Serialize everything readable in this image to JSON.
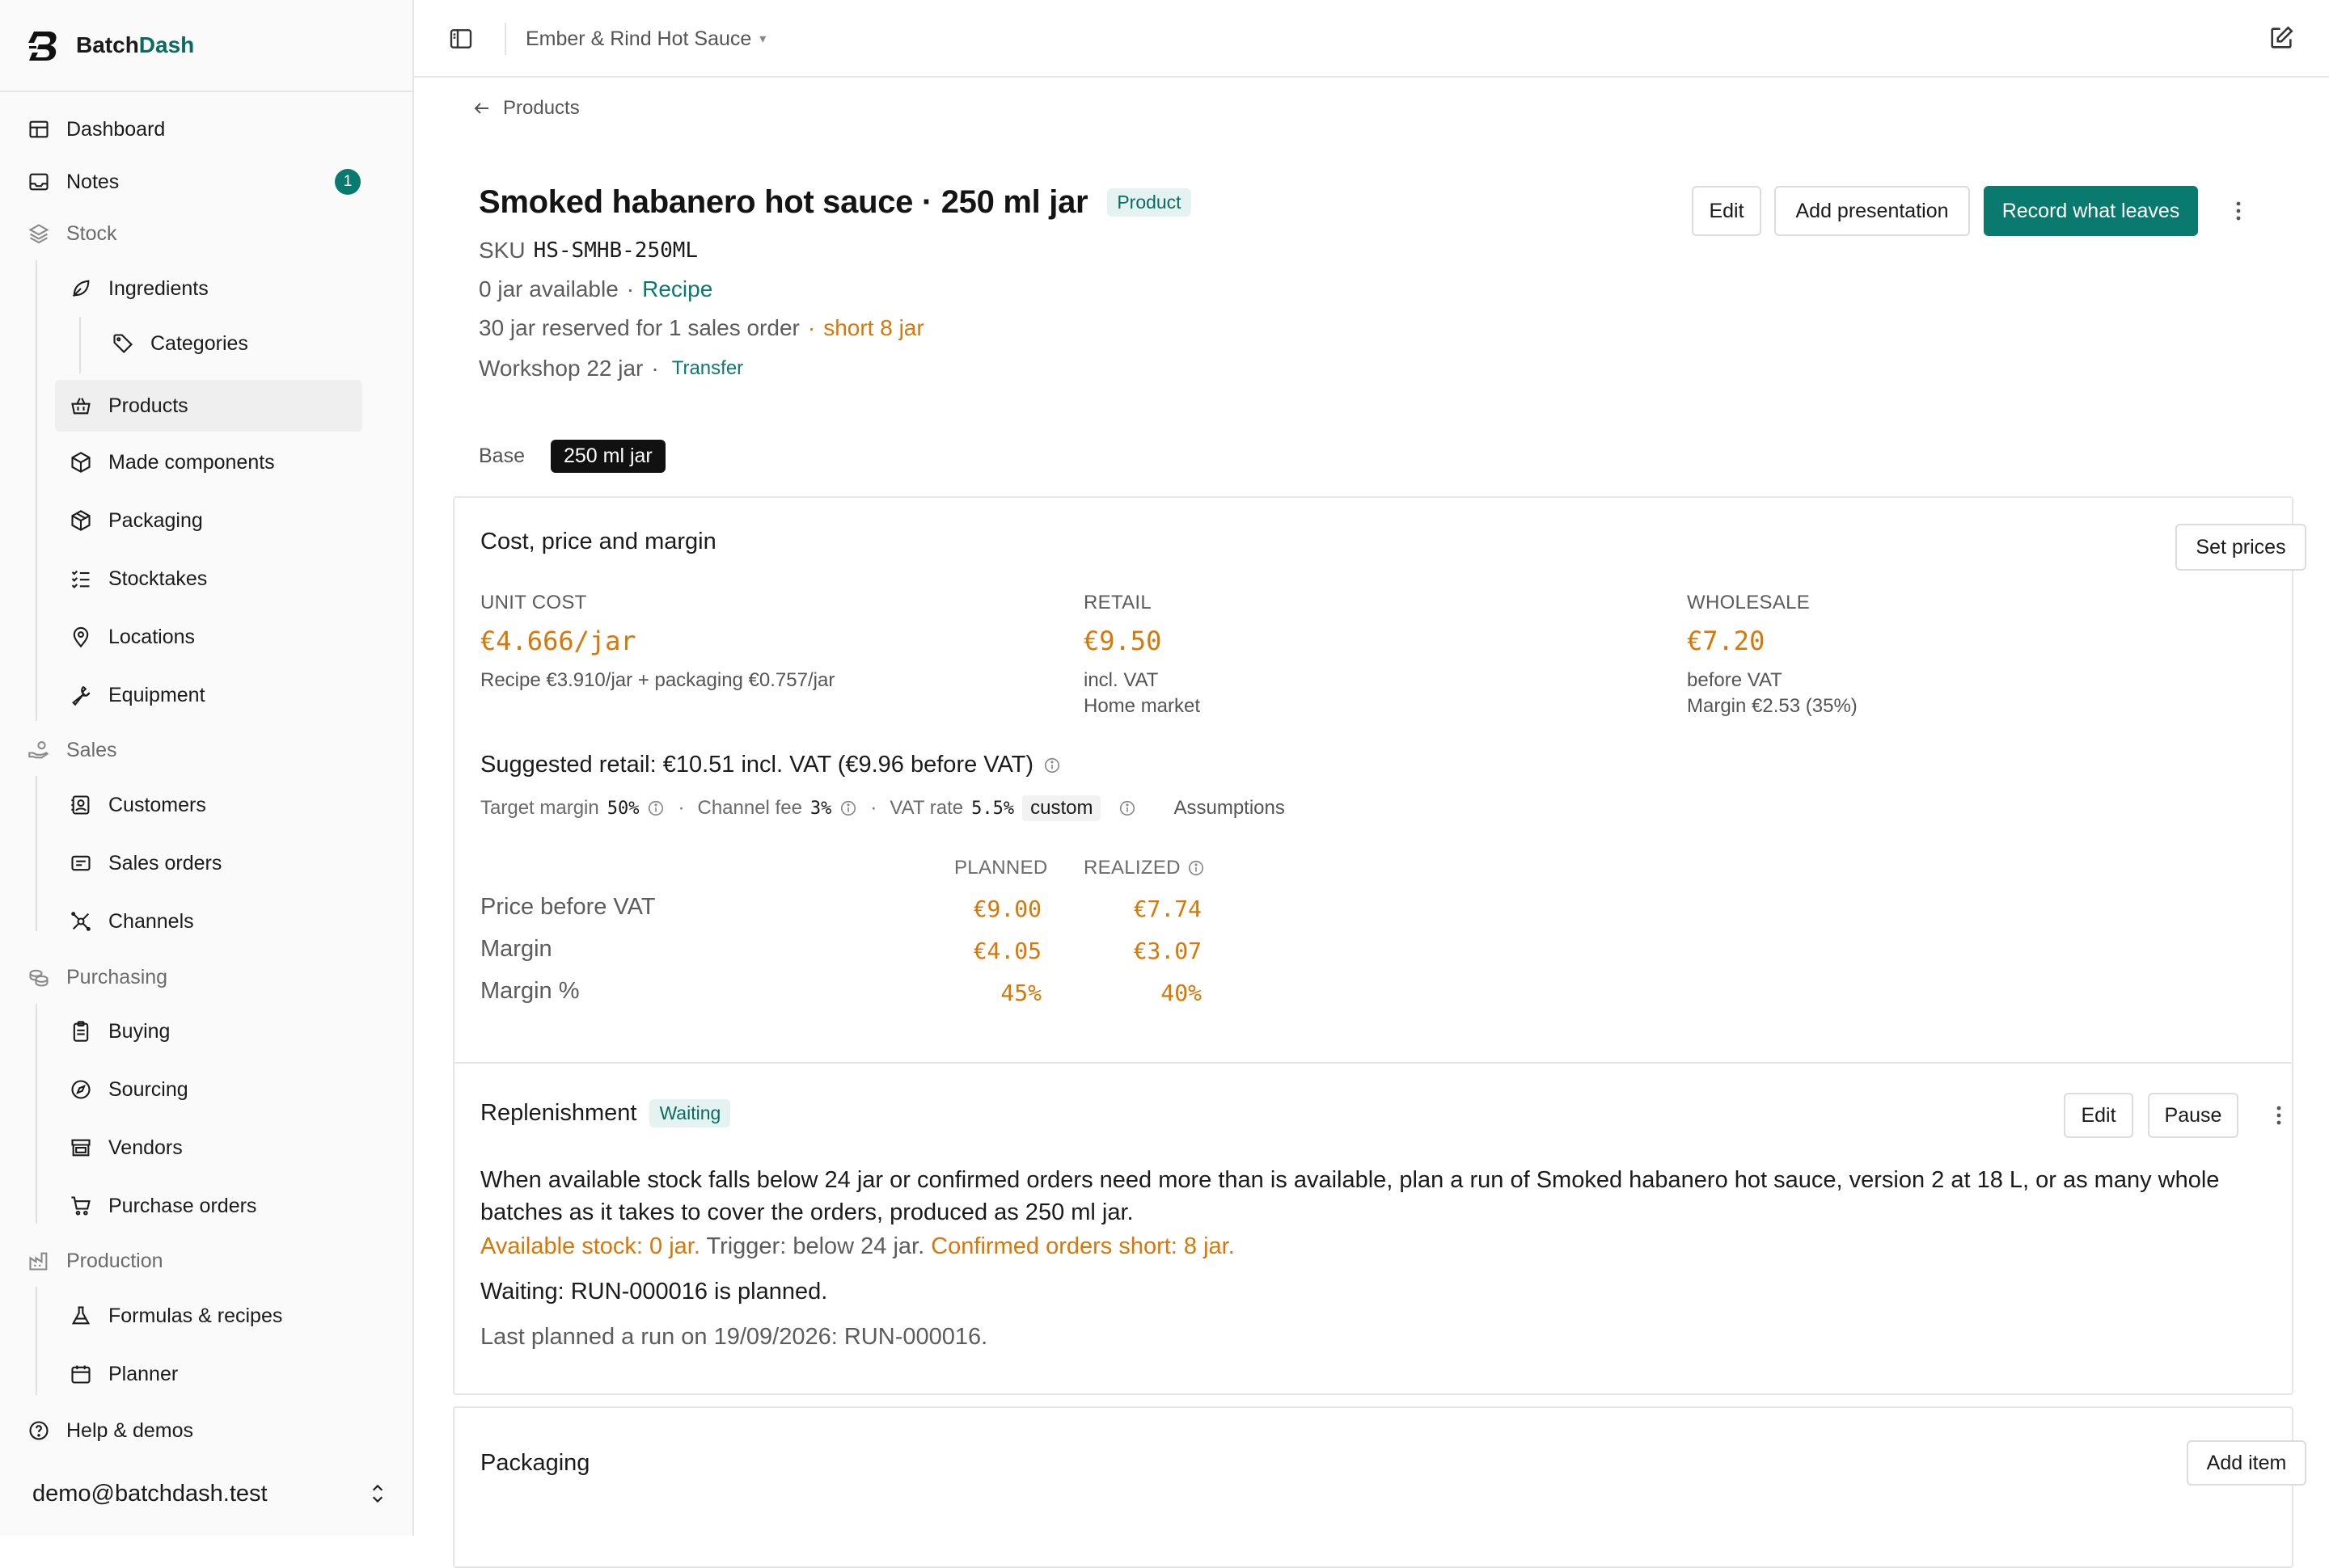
{
  "app": {
    "brand_first": "Batch",
    "brand_second": "Dash"
  },
  "sidebar": {
    "items": [
      {
        "label": "Dashboard"
      },
      {
        "label": "Notes",
        "badge": "1"
      },
      {
        "label": "Stock"
      },
      {
        "label": "Ingredients"
      },
      {
        "label": "Categories"
      },
      {
        "label": "Products"
      },
      {
        "label": "Made components"
      },
      {
        "label": "Packaging"
      },
      {
        "label": "Stocktakes"
      },
      {
        "label": "Locations"
      },
      {
        "label": "Equipment"
      },
      {
        "label": "Sales"
      },
      {
        "label": "Customers"
      },
      {
        "label": "Sales orders"
      },
      {
        "label": "Channels"
      },
      {
        "label": "Purchasing"
      },
      {
        "label": "Buying"
      },
      {
        "label": "Sourcing"
      },
      {
        "label": "Vendors"
      },
      {
        "label": "Purchase orders"
      },
      {
        "label": "Production"
      },
      {
        "label": "Formulas & recipes"
      },
      {
        "label": "Planner"
      },
      {
        "label": "Help & demos"
      }
    ],
    "user_email": "demo@batchdash.test"
  },
  "topbar": {
    "workspace": "Ember & Rind Hot Sauce",
    "caret": "▾"
  },
  "breadcrumb": {
    "back_label": "Products"
  },
  "product": {
    "title": "Smoked habanero hot sauce · 250 ml jar",
    "type_badge": "Product",
    "sku_label": "SKU",
    "sku_value": "HS-SMHB-250ML",
    "available": "0 jar available",
    "dot": "·",
    "recipe_link": "Recipe",
    "reserved": "30 jar reserved for 1 sales order",
    "short": "short 8 jar",
    "location": "Workshop 22 jar",
    "transfer_link": "Transfer"
  },
  "actions": {
    "edit": "Edit",
    "add_presentation": "Add presentation",
    "record": "Record what leaves"
  },
  "variant_tabs": [
    "Base",
    "250 ml jar"
  ],
  "pricing": {
    "title": "Cost, price and margin",
    "set_prices": "Set prices",
    "unit_cost": {
      "label": "UNIT COST",
      "value": "€4.666/jar",
      "sub1": "Recipe €3.910/jar + packaging €0.757/jar"
    },
    "retail": {
      "label": "RETAIL",
      "value": "€9.50",
      "sub1": "incl. VAT",
      "sub2": "Home market"
    },
    "wholesale": {
      "label": "WHOLESALE",
      "value": "€7.20",
      "sub1": "before VAT",
      "sub2": "Margin €2.53 (35%)"
    },
    "suggested": "Suggested retail: €10.51 incl. VAT (€9.96 before VAT)",
    "target_margin_label": "Target margin",
    "target_margin": "50%",
    "channel_fee_label": "Channel fee",
    "channel_fee": "3%",
    "vat_label": "VAT rate",
    "vat_rate": "5.5%",
    "vat_custom": "custom",
    "assumptions": "Assumptions",
    "planned_label": "PLANNED",
    "realized_label": "REALIZED",
    "rows": [
      {
        "label": "Price before VAT",
        "planned": "€9.00",
        "realized": "€7.74"
      },
      {
        "label": "Margin",
        "planned": "€4.05",
        "realized": "€3.07"
      },
      {
        "label": "Margin %",
        "planned": "45%",
        "realized": "40%"
      }
    ]
  },
  "replenishment": {
    "title": "Replenishment",
    "status": "Waiting",
    "edit": "Edit",
    "pause": "Pause",
    "description": "When available stock falls below 24 jar or confirmed orders need more than is available, plan a run of Smoked habanero hot sauce, version 2 at 18 L, or as many whole batches as it takes to cover the orders, produced as 250 ml jar.",
    "available_stock": "Available stock: 0 jar.",
    "trigger": "Trigger: below 24 jar.",
    "orders_short": "Confirmed orders short: 8 jar.",
    "waiting": "Waiting: RUN-000016 is planned.",
    "last_planned": "Last planned a run on 19/09/2026: RUN-000016."
  },
  "packaging": {
    "title": "Packaging",
    "add_item": "Add item"
  },
  "colors": {
    "accent": "#0b7a6e",
    "warning": "#d97706",
    "tag_bg": "#e4f3f1"
  },
  "icons": {
    "dashboard": "layout-icon",
    "notes": "inbox-icon",
    "stock": "layers-icon",
    "ingredients": "leaf-icon",
    "categories": "tag-icon",
    "products": "basket-icon",
    "made_components": "box-icon",
    "packaging": "package-icon",
    "stocktakes": "checklist-icon",
    "locations": "map-pin-icon",
    "equipment": "wrench-icon",
    "sales": "hand-coins-icon",
    "customers": "contact-icon",
    "sales_orders": "receipt-icon",
    "channels": "network-icon",
    "purchasing": "coins-icon",
    "buying": "clipboard-icon",
    "sourcing": "compass-icon",
    "vendors": "store-icon",
    "purchase_orders": "cart-icon",
    "production": "factory-icon",
    "formulas": "flask-icon",
    "planner": "calendar-icon",
    "help": "help-circle-icon"
  }
}
